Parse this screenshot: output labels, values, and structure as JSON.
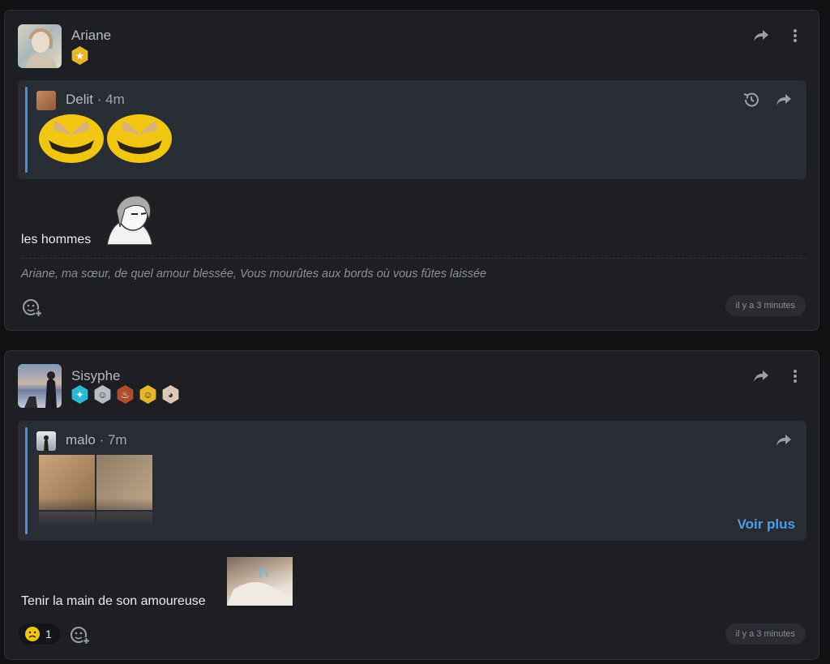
{
  "posts": [
    {
      "author": "Ariane",
      "quote": {
        "author": "Delit",
        "time": "4m"
      },
      "text": "les hommes",
      "signature": "Ariane, ma sœur, de quel amour blessée, Vous mourûtes aux bords où vous fûtes laissée",
      "timestamp": "il y a 3 minutes"
    },
    {
      "author": "Sisyphe",
      "quote": {
        "author": "malo",
        "time": "7m",
        "more_label": "Voir plus"
      },
      "text": "Tenir la main de son amoureuse",
      "reaction_count": "1",
      "timestamp": "il y a 3 minutes"
    }
  ],
  "colors": {
    "accent": "#4a90d9",
    "link": "#4a9fe8"
  }
}
